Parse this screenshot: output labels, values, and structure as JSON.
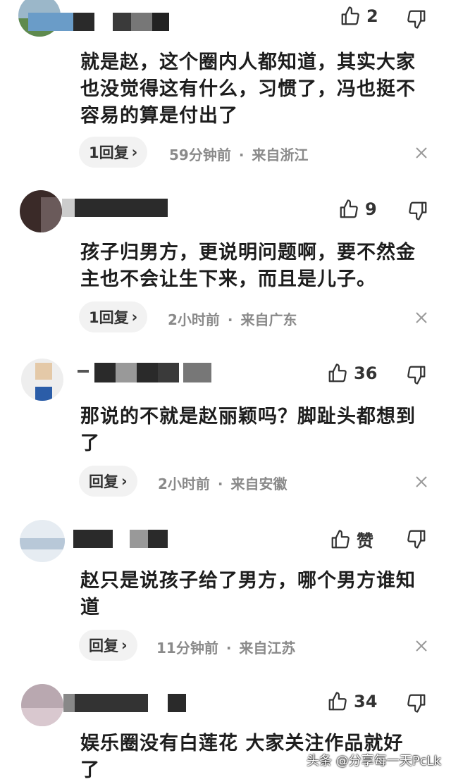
{
  "comments": [
    {
      "likes": "2",
      "text": "就是赵，这个圈内人都知道，其实大家也没觉得这有什么，习惯了，冯也挺不容易的算是付出了",
      "reply": "1回复",
      "time": "59分钟前",
      "location": "来自浙江"
    },
    {
      "likes": "9",
      "text": "孩子归男方，更说明问题啊，要不然金主也不会让生下来，而且是儿子。",
      "reply": "1回复",
      "time": "2小时前",
      "location": "来自广东"
    },
    {
      "likes": "36",
      "text": "那说的不就是赵丽颖吗？脚趾头都想到了",
      "reply": "回复",
      "time": "2小时前",
      "location": "来自安徽"
    },
    {
      "likes": "赞",
      "text": "赵只是说孩子给了男方，哪个男方谁知道",
      "reply": "回复",
      "time": "11分钟前",
      "location": "来自江苏"
    },
    {
      "likes": "34",
      "text": "娱乐圈没有白莲花 大家关注作品就好了",
      "reply": "",
      "time": "",
      "location": ""
    }
  ],
  "separator": "·",
  "reply_arrow": "›",
  "watermark": "头条 @分享每一天PcLk",
  "colors": {
    "text": "#1d1d1d",
    "meta": "#8a8a8a",
    "pill": "#f2f2f2"
  },
  "icons": [
    "thumbs-up-icon",
    "thumbs-down-icon",
    "close-icon"
  ]
}
